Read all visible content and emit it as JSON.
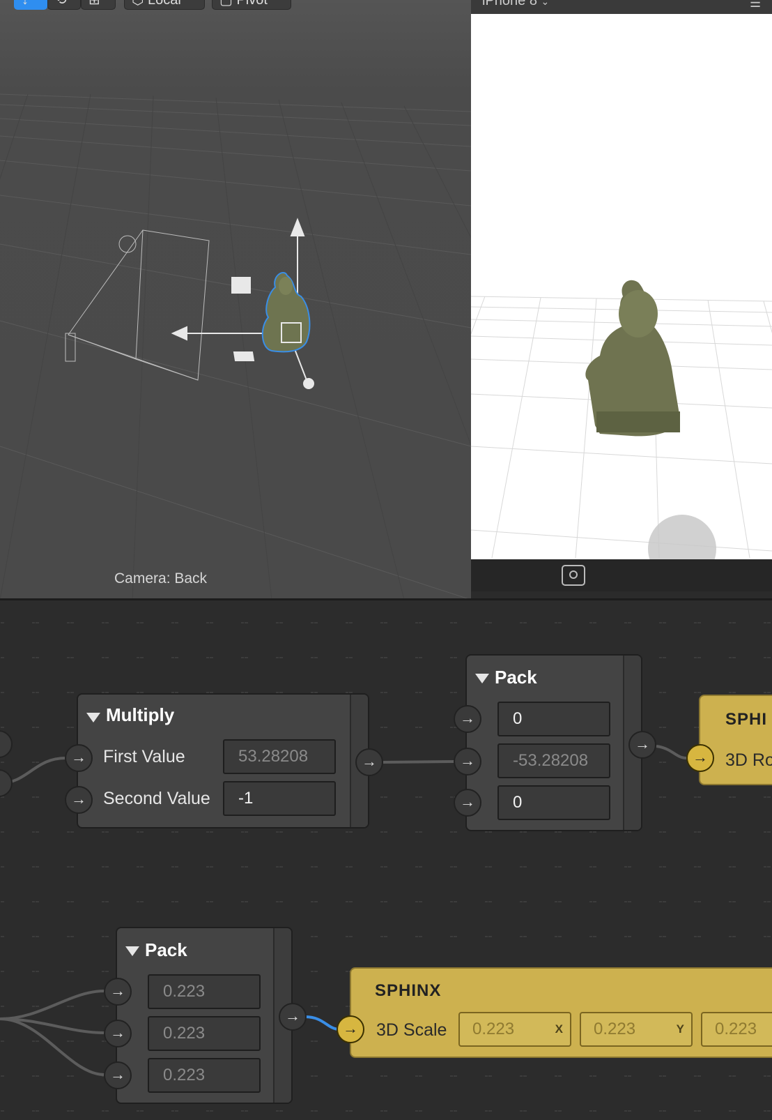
{
  "toolbar": {
    "local_label": "Local",
    "pivot_label": "Pivot"
  },
  "viewport": {
    "camera_label": "Camera: Back"
  },
  "preview": {
    "device_label": "iPhone 8"
  },
  "graph": {
    "multiply": {
      "title": "Multiply",
      "first_label": "First Value",
      "first_value": "53.28208",
      "second_label": "Second Value",
      "second_value": "-1"
    },
    "pack_top": {
      "title": "Pack",
      "values": [
        "0",
        "-53.28208",
        "0"
      ]
    },
    "sphinx_top": {
      "title": "SPHI",
      "field_label": "3D Ro"
    },
    "pack_bottom": {
      "title": "Pack",
      "values": [
        "0.223",
        "0.223",
        "0.223"
      ]
    },
    "sphinx_bottom": {
      "title": "SPHINX",
      "field_label": "3D Scale",
      "x_value": "0.223",
      "y_value": "0.223",
      "z_value": "0.223",
      "x_axis": "X",
      "y_axis": "Y"
    }
  },
  "colors": {
    "accent_blue": "#3a8ee6",
    "node_gold": "#cdb14f",
    "viewport_bg": "#4d4d4d",
    "graph_bg": "#2c2c2c"
  }
}
